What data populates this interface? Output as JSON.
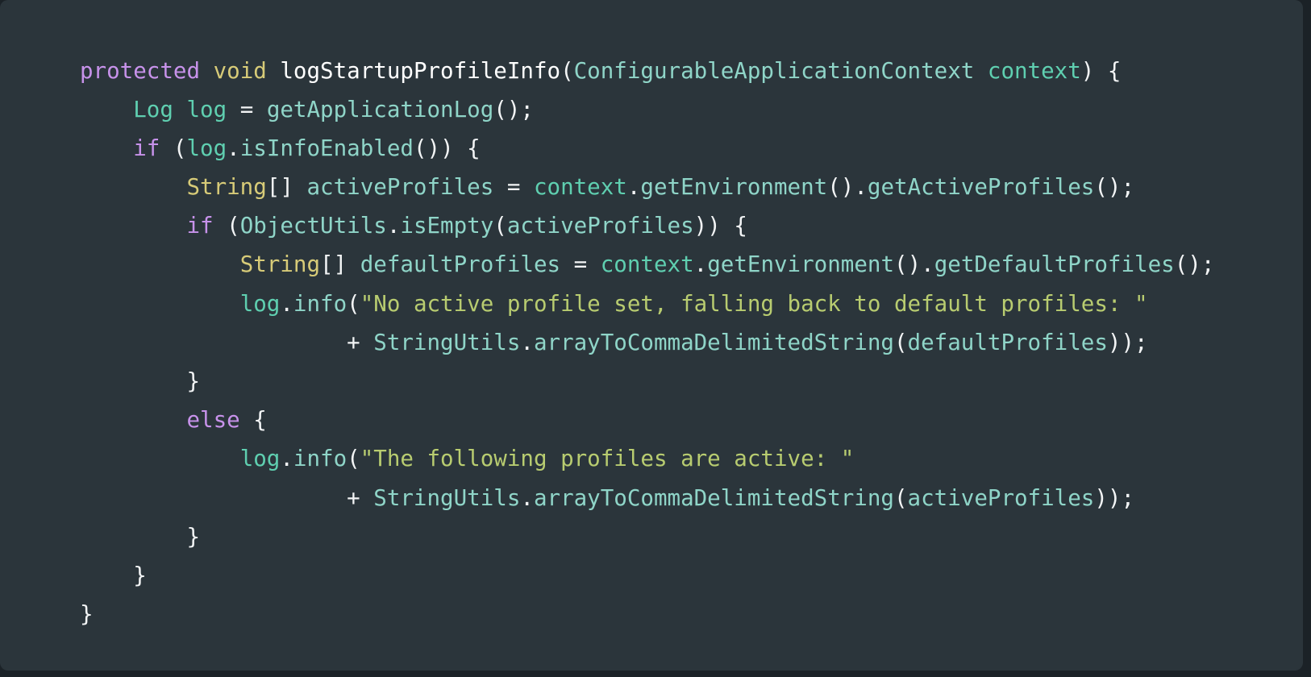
{
  "theme": {
    "page_background": "#1b2227",
    "card_background": "#2b353b",
    "keyword_color": "#c792ea",
    "type_color": "#d7cb78",
    "class_color": "#8fd5c8",
    "variable_color": "#5fcfb0",
    "identifier_color": "#8fd5c8",
    "punctuation_color": "#f2f4f5",
    "string_color": "#b8cc70",
    "method_name_color": "#ffffff"
  },
  "code": {
    "language": "java",
    "lines": [
      {
        "indent": 0,
        "tokens": [
          {
            "t": "protected",
            "c": "t-kw"
          },
          {
            "t": " ",
            "c": "t-punct"
          },
          {
            "t": "void",
            "c": "t-type"
          },
          {
            "t": " ",
            "c": "t-punct"
          },
          {
            "t": "logStartupProfileInfo",
            "c": "t-fnname"
          },
          {
            "t": "(",
            "c": "t-punct"
          },
          {
            "t": "ConfigurableApplicationContext",
            "c": "t-class"
          },
          {
            "t": " ",
            "c": "t-punct"
          },
          {
            "t": "context",
            "c": "t-var"
          },
          {
            "t": ") {",
            "c": "t-punct"
          }
        ]
      },
      {
        "indent": 1,
        "tokens": [
          {
            "t": "Log",
            "c": "t-var"
          },
          {
            "t": " ",
            "c": "t-punct"
          },
          {
            "t": "log",
            "c": "t-var"
          },
          {
            "t": " = ",
            "c": "t-punct"
          },
          {
            "t": "getApplicationLog",
            "c": "t-ident"
          },
          {
            "t": "();",
            "c": "t-punct"
          }
        ]
      },
      {
        "indent": 1,
        "tokens": [
          {
            "t": "if",
            "c": "t-kw"
          },
          {
            "t": " (",
            "c": "t-punct"
          },
          {
            "t": "log",
            "c": "t-var"
          },
          {
            "t": ".",
            "c": "t-punct"
          },
          {
            "t": "isInfoEnabled",
            "c": "t-ident"
          },
          {
            "t": "()) {",
            "c": "t-punct"
          }
        ]
      },
      {
        "indent": 2,
        "tokens": [
          {
            "t": "String",
            "c": "t-type"
          },
          {
            "t": "[]",
            "c": "t-punct"
          },
          {
            "t": " ",
            "c": "t-punct"
          },
          {
            "t": "activeProfiles",
            "c": "t-ident"
          },
          {
            "t": " = ",
            "c": "t-punct"
          },
          {
            "t": "context",
            "c": "t-var"
          },
          {
            "t": ".",
            "c": "t-punct"
          },
          {
            "t": "getEnvironment",
            "c": "t-ident"
          },
          {
            "t": "()",
            "c": "t-punct"
          },
          {
            "t": ".",
            "c": "t-punct"
          },
          {
            "t": "getActiveProfiles",
            "c": "t-ident"
          },
          {
            "t": "();",
            "c": "t-punct"
          }
        ]
      },
      {
        "indent": 2,
        "tokens": [
          {
            "t": "if",
            "c": "t-kw"
          },
          {
            "t": " (",
            "c": "t-punct"
          },
          {
            "t": "ObjectUtils",
            "c": "t-class"
          },
          {
            "t": ".",
            "c": "t-punct"
          },
          {
            "t": "isEmpty",
            "c": "t-ident"
          },
          {
            "t": "(",
            "c": "t-punct"
          },
          {
            "t": "activeProfiles",
            "c": "t-ident"
          },
          {
            "t": ")) {",
            "c": "t-punct"
          }
        ]
      },
      {
        "indent": 3,
        "tokens": [
          {
            "t": "String",
            "c": "t-type"
          },
          {
            "t": "[]",
            "c": "t-punct"
          },
          {
            "t": " ",
            "c": "t-punct"
          },
          {
            "t": "defaultProfiles",
            "c": "t-ident"
          },
          {
            "t": " = ",
            "c": "t-punct"
          },
          {
            "t": "context",
            "c": "t-var"
          },
          {
            "t": ".",
            "c": "t-punct"
          },
          {
            "t": "getEnvironment",
            "c": "t-ident"
          },
          {
            "t": "()",
            "c": "t-punct"
          },
          {
            "t": ".",
            "c": "t-punct"
          },
          {
            "t": "getDefaultProfiles",
            "c": "t-ident"
          },
          {
            "t": "();",
            "c": "t-punct"
          }
        ]
      },
      {
        "indent": 3,
        "tokens": [
          {
            "t": "log",
            "c": "t-var"
          },
          {
            "t": ".",
            "c": "t-punct"
          },
          {
            "t": "info",
            "c": "t-ident"
          },
          {
            "t": "(",
            "c": "t-punct"
          },
          {
            "t": "\"No active profile set, falling back to default profiles: \"",
            "c": "t-str"
          }
        ]
      },
      {
        "indent": 5,
        "tokens": [
          {
            "t": "+ ",
            "c": "t-punct"
          },
          {
            "t": "StringUtils",
            "c": "t-class"
          },
          {
            "t": ".",
            "c": "t-punct"
          },
          {
            "t": "arrayToCommaDelimitedString",
            "c": "t-ident"
          },
          {
            "t": "(",
            "c": "t-punct"
          },
          {
            "t": "defaultProfiles",
            "c": "t-ident"
          },
          {
            "t": "));",
            "c": "t-punct"
          }
        ]
      },
      {
        "indent": 2,
        "tokens": [
          {
            "t": "}",
            "c": "t-punct"
          }
        ]
      },
      {
        "indent": 2,
        "tokens": [
          {
            "t": "else",
            "c": "t-kw"
          },
          {
            "t": " {",
            "c": "t-punct"
          }
        ]
      },
      {
        "indent": 3,
        "tokens": [
          {
            "t": "log",
            "c": "t-var"
          },
          {
            "t": ".",
            "c": "t-punct"
          },
          {
            "t": "info",
            "c": "t-ident"
          },
          {
            "t": "(",
            "c": "t-punct"
          },
          {
            "t": "\"The following profiles are active: \"",
            "c": "t-str"
          }
        ]
      },
      {
        "indent": 5,
        "tokens": [
          {
            "t": "+ ",
            "c": "t-punct"
          },
          {
            "t": "StringUtils",
            "c": "t-class"
          },
          {
            "t": ".",
            "c": "t-punct"
          },
          {
            "t": "arrayToCommaDelimitedString",
            "c": "t-ident"
          },
          {
            "t": "(",
            "c": "t-punct"
          },
          {
            "t": "activeProfiles",
            "c": "t-ident"
          },
          {
            "t": "));",
            "c": "t-punct"
          }
        ]
      },
      {
        "indent": 2,
        "tokens": [
          {
            "t": "}",
            "c": "t-punct"
          }
        ]
      },
      {
        "indent": 1,
        "tokens": [
          {
            "t": "}",
            "c": "t-punct"
          }
        ]
      },
      {
        "indent": 0,
        "tokens": [
          {
            "t": "}",
            "c": "t-punct"
          }
        ]
      }
    ]
  }
}
